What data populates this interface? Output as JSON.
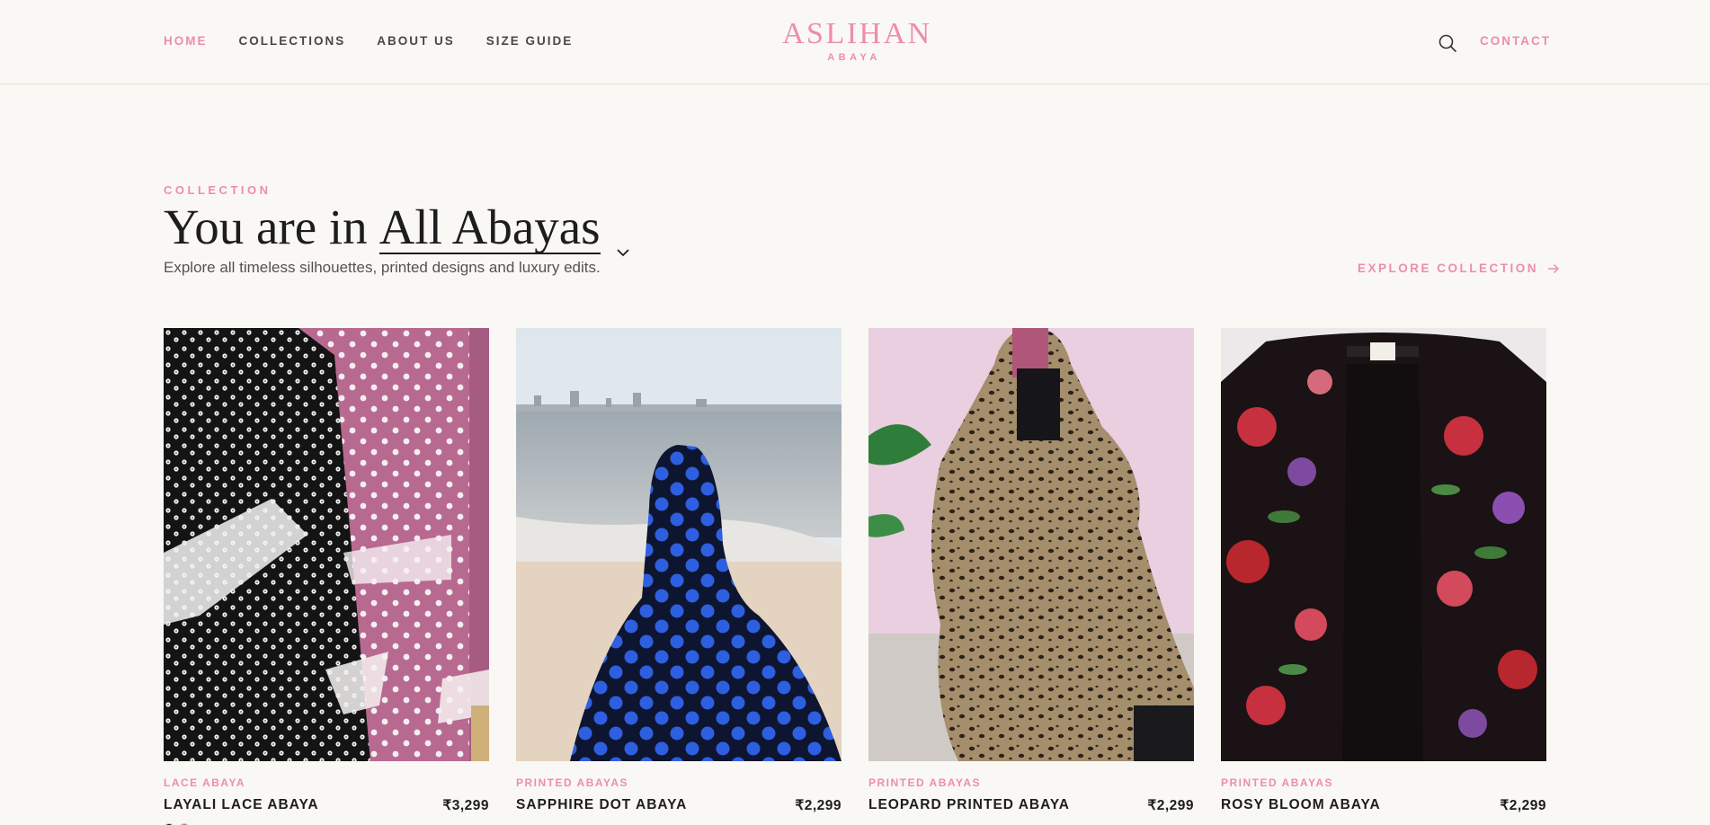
{
  "brand": {
    "name": "ASLIHAN",
    "tagline": "ABAYA",
    "color": "#ec8eaa"
  },
  "nav": {
    "items": [
      {
        "label": "HOME",
        "active": true
      },
      {
        "label": "COLLECTIONS",
        "active": false
      },
      {
        "label": "ABOUT US",
        "active": false
      },
      {
        "label": "SIZE GUIDE",
        "active": false
      }
    ],
    "contact_label": "CONTACT",
    "search_icon": "search-icon"
  },
  "intro": {
    "eyebrow": "COLLECTION",
    "heading_prefix": "You are in",
    "selected_collection": "All Abayas",
    "description": "Explore all timeless silhouettes, printed designs and luxury edits.",
    "explore_label": "EXPLORE COLLECTION"
  },
  "products": [
    {
      "category": "LACE ABAYA",
      "name": "LAYALI LACE ABAYA",
      "price": "₹3,299",
      "swatches": [
        "#111111",
        "#c86a8c"
      ]
    },
    {
      "category": "PRINTED ABAYAS",
      "name": "SAPPHIRE DOT ABAYA",
      "price": "₹2,299"
    },
    {
      "category": "PRINTED ABAYAS",
      "name": "LEOPARD PRINTED ABAYA",
      "price": "₹2,299"
    },
    {
      "category": "PRINTED ABAYAS",
      "name": "ROSY BLOOM ABAYA",
      "price": "₹2,299"
    }
  ]
}
